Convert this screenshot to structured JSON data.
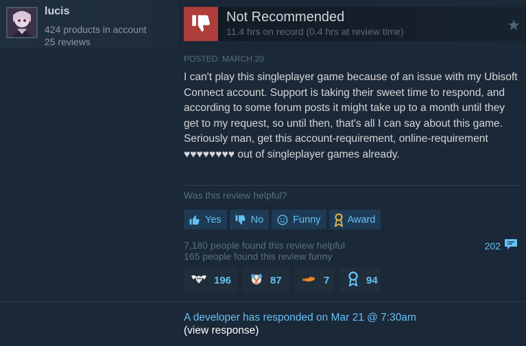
{
  "author": {
    "name": "lucis",
    "products": "424 products in account",
    "reviews": "25 reviews"
  },
  "review": {
    "verdict": "Not Recommended",
    "hours": "11.4 hrs on record (0.4 hrs at review time)",
    "posted": "POSTED: MARCH 20",
    "text": "I can't play this singleplayer game because of an issue with my Ubisoft Connect account. Support is taking their sweet time to respond, and according to some forum posts it might take up to a month until they get to my request, so until then, that's all I can say about this game. Seriously man, get this account-requirement, online-requirement ♥♥♥♥♥♥♥♥ out of singleplayer games already."
  },
  "helpful": {
    "question": "Was this review helpful?",
    "buttons": {
      "yes": "Yes",
      "no": "No",
      "funny": "Funny",
      "award": "Award"
    },
    "helpful_count": "7,180 people found this review helpful",
    "funny_count": "165 people found this review funny",
    "comments": "202"
  },
  "awards": [
    {
      "icon": "winged-skull-award-icon",
      "count": "196"
    },
    {
      "icon": "clown-face-award-icon",
      "count": "87"
    },
    {
      "icon": "pointing-hand-award-icon",
      "count": "7"
    },
    {
      "icon": "medal-award-icon",
      "count": "94"
    }
  ],
  "developer": {
    "response": "A developer has responded on Mar 21 @ 7:30am",
    "view": "(view response)"
  },
  "colors": {
    "background": "#1b2838",
    "accent": "#66c0f4",
    "thumb_down": "#ad3e3a"
  }
}
